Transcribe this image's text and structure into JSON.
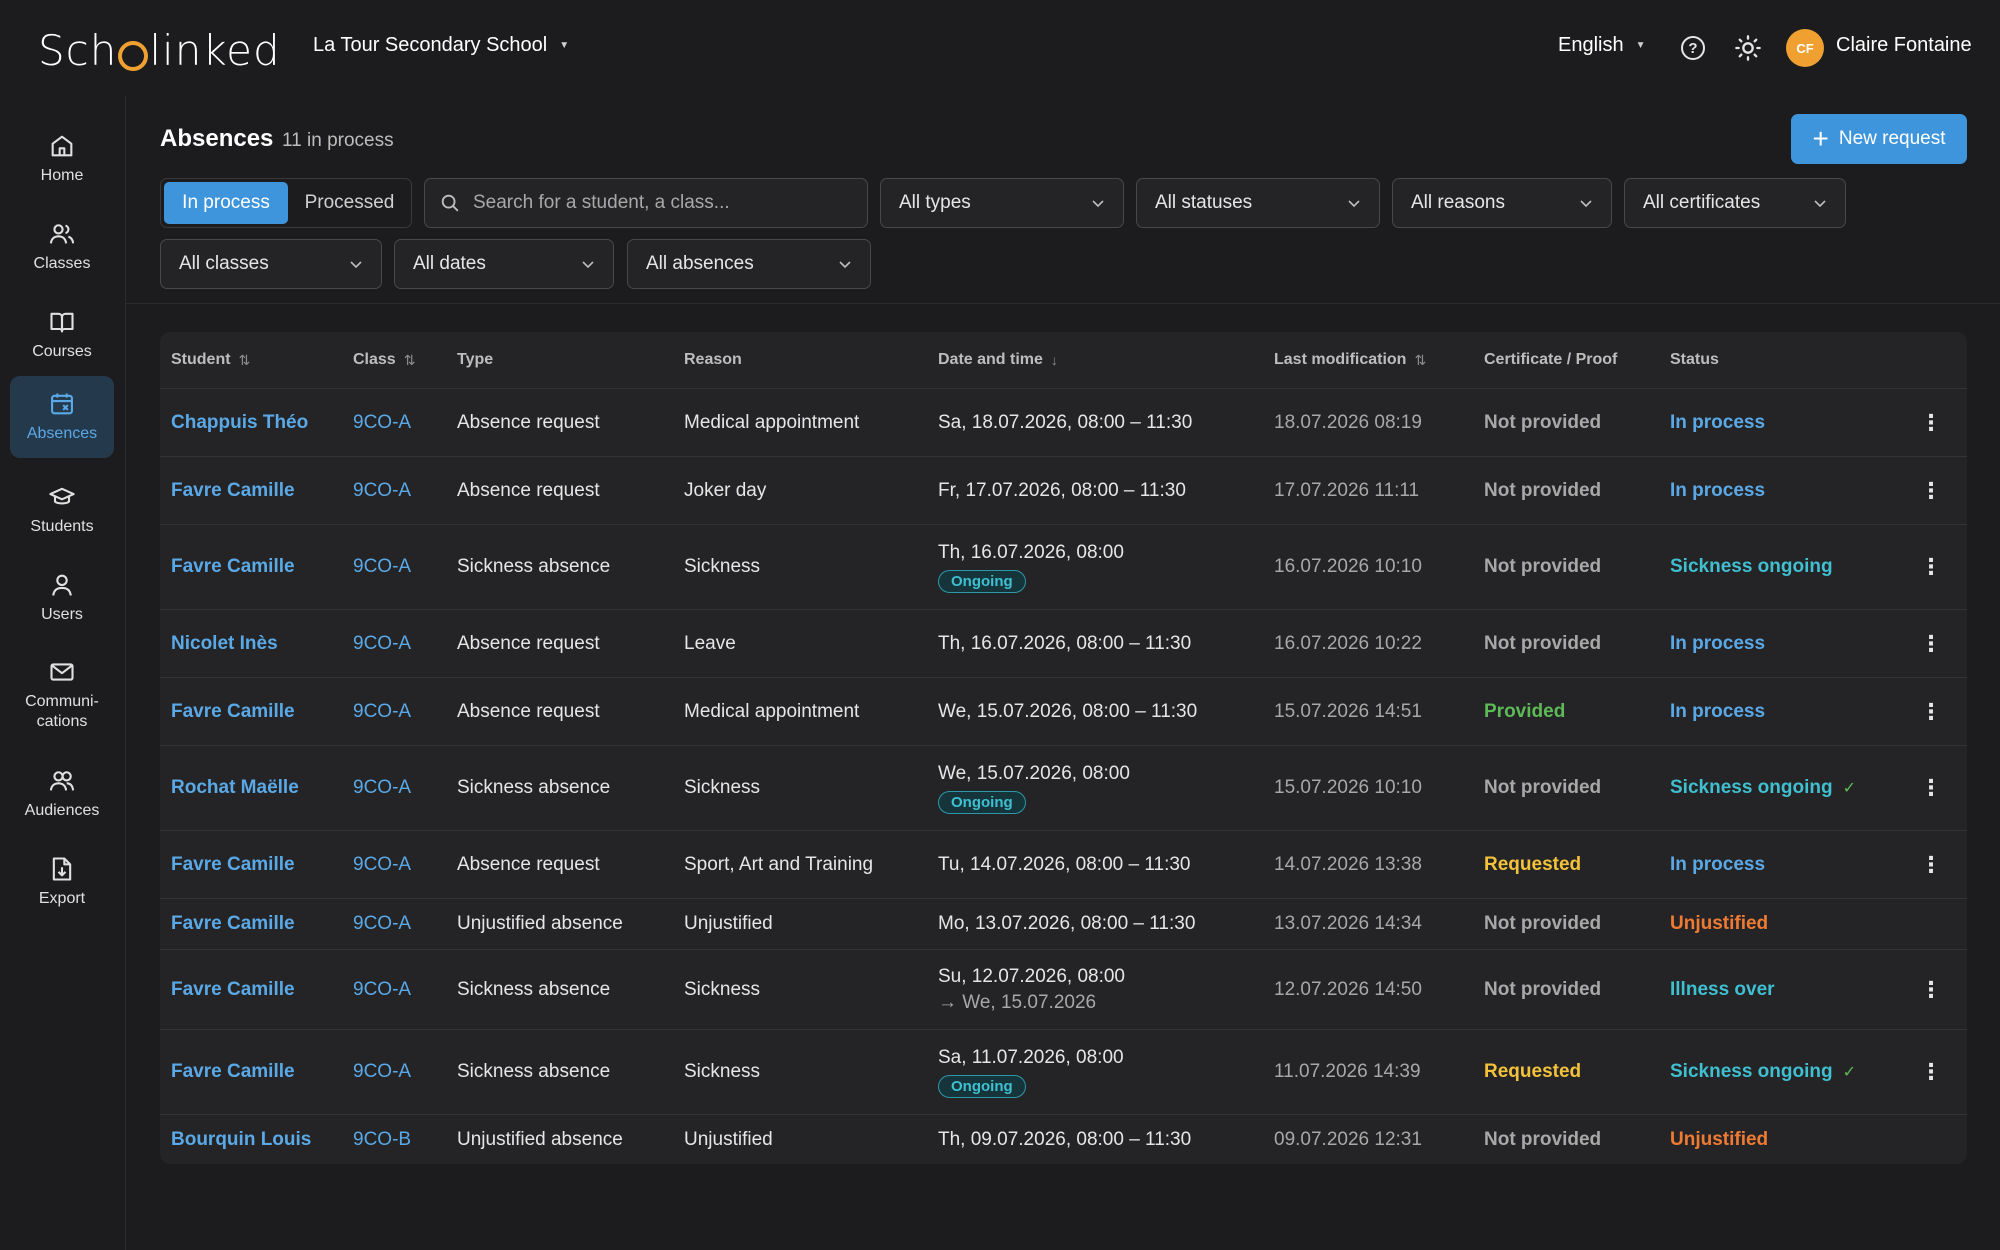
{
  "app": {
    "logo_text": "Schoolinked",
    "school": "La Tour Secondary School",
    "language": "English",
    "user": {
      "initials": "CF",
      "name": "Claire Fontaine"
    }
  },
  "sidebar": {
    "items": [
      {
        "label": "Home",
        "icon": "home-icon",
        "active": false
      },
      {
        "label": "Classes",
        "icon": "users-icon",
        "active": false
      },
      {
        "label": "Courses",
        "icon": "book-icon",
        "active": false
      },
      {
        "label": "Absences",
        "icon": "calendar-x-icon",
        "active": true
      },
      {
        "label": "Students",
        "icon": "graduation-cap-icon",
        "active": false
      },
      {
        "label": "Users",
        "icon": "user-icon",
        "active": false
      },
      {
        "label": "Communi-\ncations",
        "icon": "mail-icon",
        "active": false
      },
      {
        "label": "Audiences",
        "icon": "audience-icon",
        "active": false
      },
      {
        "label": "Export",
        "icon": "export-icon",
        "active": false
      }
    ]
  },
  "header": {
    "title": "Absences",
    "count": "11 in process",
    "new_request": "New request"
  },
  "filters": {
    "tab_in_process": "In process",
    "tab_processed": "Processed",
    "search_placeholder": "Search for a student, a class...",
    "types": "All types",
    "statuses": "All statuses",
    "reasons": "All reasons",
    "certificates": "All certificates",
    "classes": "All classes",
    "dates": "All dates",
    "absences": "All absences"
  },
  "table": {
    "columns": {
      "student": "Student",
      "class": "Class",
      "type": "Type",
      "reason": "Reason",
      "date": "Date and time",
      "modified": "Last modification",
      "certificate": "Certificate / Proof",
      "status": "Status"
    },
    "rows": [
      {
        "student": "Chappuis Théo",
        "class": "9CO-A",
        "type": "Absence request",
        "reason": "Medical appointment",
        "date": "Sa, 18.07.2026, 08:00 – 11:30",
        "date_extra": "",
        "badge": "",
        "modified": "18.07.2026 08:19",
        "certificate": "Not provided",
        "cert_color": "grey",
        "status": "In process",
        "status_color": "blue",
        "check": false,
        "menu": true
      },
      {
        "student": "Favre Camille",
        "class": "9CO-A",
        "type": "Absence request",
        "reason": "Joker day",
        "date": "Fr, 17.07.2026, 08:00 – 11:30",
        "date_extra": "",
        "badge": "",
        "modified": "17.07.2026 11:11",
        "certificate": "Not provided",
        "cert_color": "grey",
        "status": "In process",
        "status_color": "blue",
        "check": false,
        "menu": true
      },
      {
        "student": "Favre Camille",
        "class": "9CO-A",
        "type": "Sickness absence",
        "reason": "Sickness",
        "date": "Th, 16.07.2026, 08:00",
        "date_extra": "",
        "badge": "Ongoing",
        "modified": "16.07.2026 10:10",
        "certificate": "Not provided",
        "cert_color": "grey",
        "status": "Sickness ongoing",
        "status_color": "cyan",
        "check": false,
        "menu": true
      },
      {
        "student": "Nicolet Inès",
        "class": "9CO-A",
        "type": "Absence request",
        "reason": "Leave",
        "date": "Th, 16.07.2026, 08:00 – 11:30",
        "date_extra": "",
        "badge": "",
        "modified": "16.07.2026 10:22",
        "certificate": "Not provided",
        "cert_color": "grey",
        "status": "In process",
        "status_color": "blue",
        "check": false,
        "menu": true
      },
      {
        "student": "Favre Camille",
        "class": "9CO-A",
        "type": "Absence request",
        "reason": "Medical appointment",
        "date": "We, 15.07.2026, 08:00 – 11:30",
        "date_extra": "",
        "badge": "",
        "modified": "15.07.2026 14:51",
        "certificate": "Provided",
        "cert_color": "green",
        "status": "In process",
        "status_color": "blue",
        "check": false,
        "menu": true
      },
      {
        "student": "Rochat Maëlle",
        "class": "9CO-A",
        "type": "Sickness absence",
        "reason": "Sickness",
        "date": "We, 15.07.2026, 08:00",
        "date_extra": "",
        "badge": "Ongoing",
        "modified": "15.07.2026 10:10",
        "certificate": "Not provided",
        "cert_color": "grey",
        "status": "Sickness ongoing",
        "status_color": "cyan",
        "check": true,
        "menu": true
      },
      {
        "student": "Favre Camille",
        "class": "9CO-A",
        "type": "Absence request",
        "reason": "Sport, Art and Training",
        "date": "Tu, 14.07.2026, 08:00 – 11:30",
        "date_extra": "",
        "badge": "",
        "modified": "14.07.2026 13:38",
        "certificate": "Requested",
        "cert_color": "yellow",
        "status": "In process",
        "status_color": "blue",
        "check": false,
        "menu": true
      },
      {
        "student": "Favre Camille",
        "class": "9CO-A",
        "type": "Unjustified absence",
        "reason": "Unjustified",
        "date": "Mo, 13.07.2026, 08:00 – 11:30",
        "date_extra": "",
        "badge": "",
        "modified": "13.07.2026 14:34",
        "certificate": "Not provided",
        "cert_color": "grey",
        "status": "Unjustified",
        "status_color": "orange",
        "check": false,
        "menu": false
      },
      {
        "student": "Favre Camille",
        "class": "9CO-A",
        "type": "Sickness absence",
        "reason": "Sickness",
        "date": "Su, 12.07.2026, 08:00",
        "date_extra": "→ We, 15.07.2026",
        "badge": "",
        "modified": "12.07.2026 14:50",
        "certificate": "Not provided",
        "cert_color": "grey",
        "status": "Illness over",
        "status_color": "cyan",
        "check": false,
        "menu": true
      },
      {
        "student": "Favre Camille",
        "class": "9CO-A",
        "type": "Sickness absence",
        "reason": "Sickness",
        "date": "Sa, 11.07.2026, 08:00",
        "date_extra": "",
        "badge": "Ongoing",
        "modified": "11.07.2026 14:39",
        "certificate": "Requested",
        "cert_color": "yellow",
        "status": "Sickness ongoing",
        "status_color": "cyan",
        "check": true,
        "menu": true
      },
      {
        "student": "Bourquin Louis",
        "class": "9CO-B",
        "type": "Unjustified absence",
        "reason": "Unjustified",
        "date": "Th, 09.07.2026, 08:00 – 11:30",
        "date_extra": "",
        "badge": "",
        "modified": "09.07.2026 12:31",
        "certificate": "Not provided",
        "cert_color": "grey",
        "status": "Unjustified",
        "status_color": "orange",
        "check": false,
        "menu": false
      }
    ]
  },
  "colors": {
    "accent": "#3e95dc",
    "link": "#5aa9e6",
    "ongoing": "#3fbfd0",
    "provided": "#5dba57",
    "requested": "#f2c23a",
    "unjustified": "#ef7a34"
  }
}
